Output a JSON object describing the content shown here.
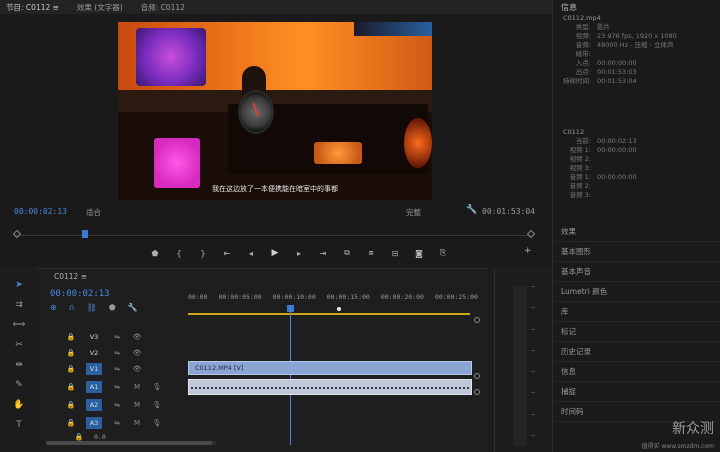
{
  "tabs": [
    {
      "label": "节目: C0112 ≡",
      "active": true
    },
    {
      "label": "效果 (文字器)",
      "active": false
    },
    {
      "label": "音频: C0112",
      "active": false
    }
  ],
  "monitor": {
    "subtitle": "我在这边放了一本便携能在暗室中的事都",
    "timecode": "00:00:02:13",
    "fit": "适合",
    "quality": "完整",
    "duration": "00:01:53:04"
  },
  "transport": {
    "buttons": [
      "marker-icon",
      "in-icon",
      "out-icon",
      "goto-in-icon",
      "step-back-icon",
      "play-icon",
      "step-forward-icon",
      "goto-out-icon",
      "insert-icon",
      "overwrite-icon",
      "lift-icon",
      "camera-icon",
      "export-icon"
    ],
    "plus": "+"
  },
  "tools": [
    "selection-icon",
    "track-select-icon",
    "ripple-icon",
    "razor-icon",
    "slip-icon",
    "pen-icon",
    "hand-icon",
    "type-icon"
  ],
  "timeline": {
    "sequence_tab": "C0112 ≡",
    "timecode": "00:00:02:13",
    "ruler": [
      "00:00",
      "00:00:05:00",
      "00:00:10:00",
      "00:00:15:00",
      "00:00:20:00",
      "00:00:25:00"
    ],
    "tracks": [
      {
        "label": "V3",
        "selected": false
      },
      {
        "label": "V2",
        "selected": false
      },
      {
        "label": "V1",
        "selected": true
      },
      {
        "label": "A1",
        "selected": true
      },
      {
        "label": "A2",
        "selected": true
      },
      {
        "label": "A3",
        "selected": true
      }
    ],
    "clip_v1_label": "C0112.MP4 [V]",
    "master_label": "0.0"
  },
  "right_panel": {
    "title": "信息",
    "info_header": "C0112.mp4",
    "info": [
      {
        "k": "类型:",
        "v": "影片"
      },
      {
        "k": "视频:",
        "v": "23.976 fps, 1920 x 1080"
      },
      {
        "k": "音频:",
        "v": "48000 Hz - 压缩 - 立体声"
      },
      {
        "k": "磁带:",
        "v": ""
      },
      {
        "k": "入点:",
        "v": "00:00:00:00"
      },
      {
        "k": "出点:",
        "v": "00:01:53:03"
      },
      {
        "k": "持续时间:",
        "v": "00:01:53:04"
      }
    ],
    "sequence_header": "C0112",
    "sequence_info": [
      {
        "k": "当前:",
        "v": "00:00:02:13"
      },
      {
        "k": "视频 1:",
        "v": "00:00:00:00"
      },
      {
        "k": "视频 2:",
        "v": ""
      },
      {
        "k": "视频 3:",
        "v": ""
      },
      {
        "k": "音频 1:",
        "v": "00:00:00:00"
      },
      {
        "k": "音频 2:",
        "v": ""
      },
      {
        "k": "音频 3:",
        "v": ""
      }
    ],
    "effects": [
      "效果",
      "基本图形",
      "基本声音",
      "Lumetri 颜色",
      "库",
      "标记",
      "历史记录",
      "信息",
      "捕捉",
      "时间码"
    ]
  },
  "watermark": {
    "text": "新众测",
    "url": "值得买 www.smzdm.com"
  }
}
